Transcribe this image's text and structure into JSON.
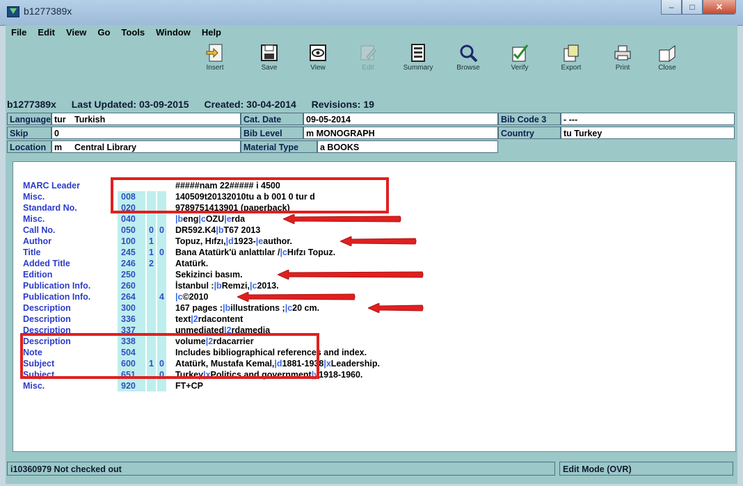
{
  "window": {
    "title": "b1277389x"
  },
  "menu": {
    "items": [
      {
        "label": "File"
      },
      {
        "label": "Edit"
      },
      {
        "label": "View"
      },
      {
        "label": "Go"
      },
      {
        "label": "Tools"
      },
      {
        "label": "Window"
      },
      {
        "label": "Help"
      }
    ]
  },
  "toolbar": {
    "buttons": [
      {
        "label": "Insert",
        "icon": "insert-icon"
      },
      {
        "label": "Save",
        "icon": "save-icon"
      },
      {
        "label": "View",
        "icon": "view-icon"
      },
      {
        "label": "Edit",
        "icon": "edit-icon",
        "disabled": true
      },
      {
        "label": "Summary",
        "icon": "summary-icon"
      },
      {
        "label": "Browse",
        "icon": "browse-icon"
      },
      {
        "label": "Verify",
        "icon": "verify-icon"
      },
      {
        "label": "Export",
        "icon": "export-icon"
      },
      {
        "label": "Print",
        "icon": "print-icon"
      },
      {
        "label": "Close",
        "icon": "close-icon"
      }
    ]
  },
  "record": {
    "id": "b1277389x",
    "last_updated": "Last Updated: 03-09-2015",
    "created": "Created: 30-04-2014",
    "revisions": "Revisions: 19"
  },
  "fixed_fields": {
    "language_label": "Language",
    "language_code": "tur",
    "language_value": "Turkish",
    "cat_date_label": "Cat. Date",
    "cat_date_value": "09-05-2014",
    "bib_code3_label": "Bib Code 3",
    "bib_code3_value": "-   ---",
    "skip_label": "Skip",
    "skip_value": "0",
    "bib_level_label": "Bib Level",
    "bib_level_value": "m   MONOGRAPH",
    "country_label": "Country",
    "country_value": "tu   Turkey",
    "location_label": "Location",
    "location_code": "m",
    "location_value": "Central Library",
    "material_type_label": "Material Type",
    "material_type_value": "a   BOOKS"
  },
  "marc": {
    "rows": [
      {
        "label": "MARC Leader",
        "tag": "",
        "i1": "",
        "i2": "",
        "data": "#####nam  22#####  i  4500"
      },
      {
        "label": "Misc.",
        "tag": "008",
        "i1": "",
        "i2": "",
        "data": "140509t20132010tu a    b    001 0 tur d"
      },
      {
        "label": "Standard No.",
        "tag": "020",
        "i1": "",
        "i2": "",
        "data": "9789751413901 (paperback)"
      },
      {
        "label": "Misc.",
        "tag": "040",
        "i1": "",
        "i2": "",
        "data": "|beng|cOZU|erda"
      },
      {
        "label": "Call No.",
        "tag": "050",
        "i1": "0",
        "i2": "0",
        "data": "DR592.K4|bT67 2013"
      },
      {
        "label": "Author",
        "tag": "100",
        "i1": "1",
        "i2": "",
        "data": "Topuz, Hıfzı,|d1923-|eauthor."
      },
      {
        "label": "Title",
        "tag": "245",
        "i1": "1",
        "i2": "0",
        "data": "Bana Atatürk'ü anlattılar /|cHıfzı Topuz."
      },
      {
        "label": "Added Title",
        "tag": "246",
        "i1": "2",
        "i2": "",
        "data": "Atatürk."
      },
      {
        "label": "Edition",
        "tag": "250",
        "i1": "",
        "i2": "",
        "data": "Sekizinci basım."
      },
      {
        "label": "Publication Info.",
        "tag": "260",
        "i1": "",
        "i2": "",
        "data": "İstanbul :|bRemzi,|c2013."
      },
      {
        "label": "Publication Info.",
        "tag": "264",
        "i1": "",
        "i2": "4",
        "data": "|c©2010"
      },
      {
        "label": "Description",
        "tag": "300",
        "i1": "",
        "i2": "",
        "data": "167 pages :|billustrations ;|c20 cm."
      },
      {
        "label": "Description",
        "tag": "336",
        "i1": "",
        "i2": "",
        "data": "text|2rdacontent"
      },
      {
        "label": "Description",
        "tag": "337",
        "i1": "",
        "i2": "",
        "data": "unmediated|2rdamedia"
      },
      {
        "label": "Description",
        "tag": "338",
        "i1": "",
        "i2": "",
        "data": "volume|2rdacarrier"
      },
      {
        "label": "Note",
        "tag": "504",
        "i1": "",
        "i2": "",
        "data": "Includes bibliographical references and index."
      },
      {
        "label": "Subject",
        "tag": "600",
        "i1": "1",
        "i2": "0",
        "data": "Atatürk, Mustafa Kemal,|d1881-1938|xLeadership."
      },
      {
        "label": "Subject",
        "tag": "651",
        "i1": "",
        "i2": "0",
        "data": "Turkey|xPolitics and government|y1918-1960."
      },
      {
        "label": "Misc.",
        "tag": "920",
        "i1": "",
        "i2": "",
        "data": "FT+CP"
      }
    ]
  },
  "status": {
    "left": "i10360979   Not checked out",
    "right": "Edit Mode (OVR)"
  },
  "colors": {
    "app_bg": "#9cc8c8",
    "marc_label": "#2c3cc8",
    "tag_bg": "#bfeeee",
    "annotation_red": "#e02020"
  }
}
